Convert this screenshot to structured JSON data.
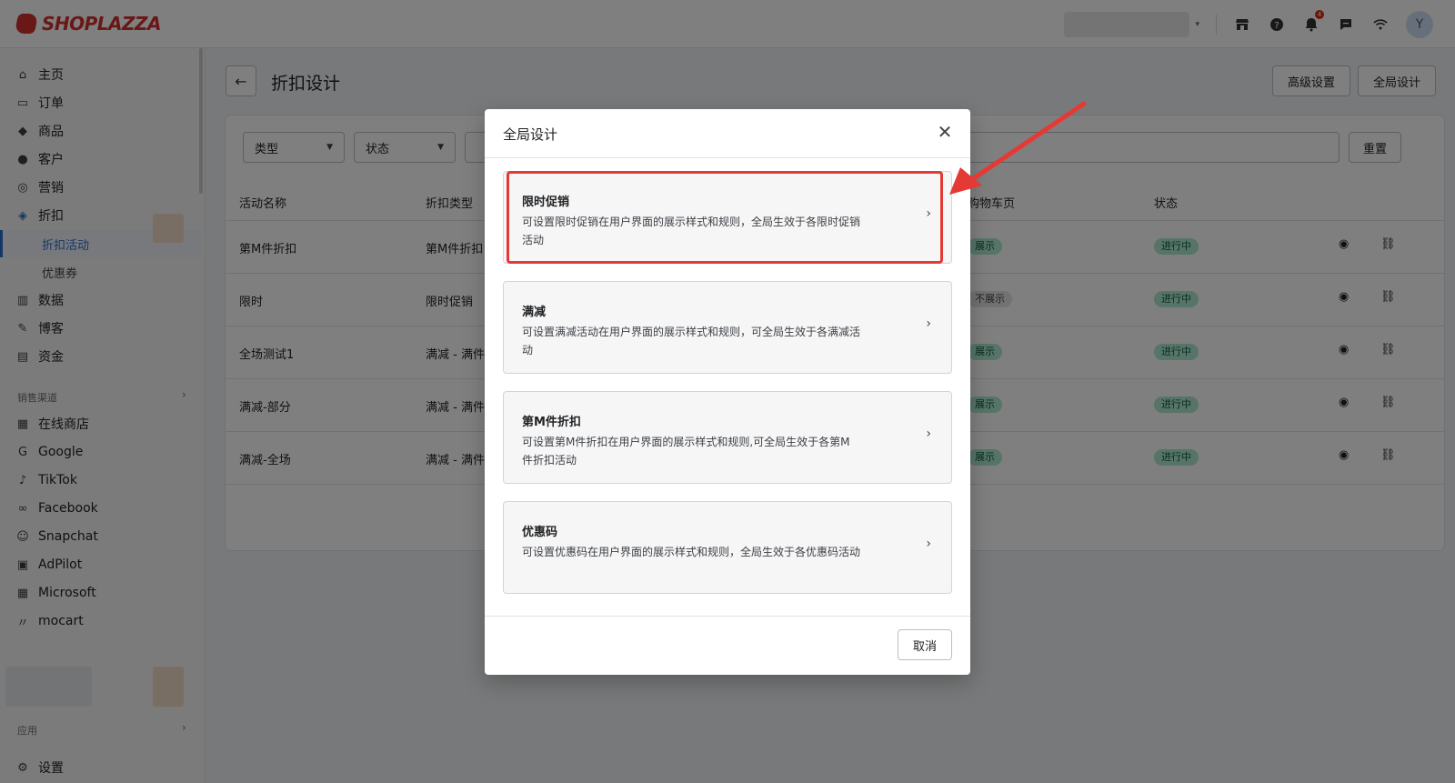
{
  "topbar": {
    "brand": "SHOPLAZZA",
    "notification_count": "4",
    "avatar_initial": "Y"
  },
  "sidebar": {
    "items": [
      {
        "label": "主页",
        "icon": "home-icon"
      },
      {
        "label": "订单",
        "icon": "inbox-icon"
      },
      {
        "label": "商品",
        "icon": "tag-icon"
      },
      {
        "label": "客户",
        "icon": "person-icon"
      },
      {
        "label": "营销",
        "icon": "target-icon"
      },
      {
        "label": "折扣",
        "icon": "discount-icon"
      }
    ],
    "discount_sub": [
      {
        "label": "折扣活动",
        "active": true
      },
      {
        "label": "优惠券",
        "active": false
      }
    ],
    "items2": [
      {
        "label": "数据",
        "icon": "bar-chart-icon"
      },
      {
        "label": "博客",
        "icon": "blog-icon"
      },
      {
        "label": "资金",
        "icon": "wallet-icon"
      }
    ],
    "sales_channel_label": "销售渠道",
    "channels": [
      {
        "label": "在线商店",
        "icon": "store-icon"
      },
      {
        "label": "Google",
        "icon": "google-icon"
      },
      {
        "label": "TikTok",
        "icon": "tiktok-icon"
      },
      {
        "label": "Facebook",
        "icon": "meta-icon"
      },
      {
        "label": "Snapchat",
        "icon": "snapchat-icon"
      },
      {
        "label": "AdPilot",
        "icon": "adpilot-icon"
      },
      {
        "label": "Microsoft",
        "icon": "microsoft-icon"
      },
      {
        "label": "mocart",
        "icon": "mocart-icon"
      }
    ],
    "apps_label": "应用",
    "settings_label": "设置"
  },
  "page": {
    "title": "折扣设计",
    "advanced_settings": "高级设置",
    "global_design": "全局设计"
  },
  "filters": {
    "type": "类型",
    "status": "状态",
    "reset": "重置"
  },
  "table": {
    "headers": {
      "name": "活动名称",
      "discount_type": "折扣类型",
      "cart_page": "购物车页",
      "status": "状态"
    },
    "rows": [
      {
        "name": "第M件折扣",
        "type": "第M件折扣",
        "cart": "展示",
        "cart_style": "green",
        "status": "进行中"
      },
      {
        "name": "限时",
        "type": "限时促销",
        "cart": "不展示",
        "cart_style": "gray",
        "status": "进行中"
      },
      {
        "name": "全场测试1",
        "type": "满减 - 满件",
        "cart": "展示",
        "cart_style": "green",
        "status": "进行中"
      },
      {
        "name": "满减-部分",
        "type": "满减 - 满件",
        "cart": "展示",
        "cart_style": "green",
        "status": "进行中"
      },
      {
        "name": "满减-全场",
        "type": "满减 - 满件",
        "cart": "展示",
        "cart_style": "green",
        "status": "进行中"
      }
    ]
  },
  "modal": {
    "title": "全局设计",
    "options": [
      {
        "title": "限时促销",
        "desc": "可设置限时促销在用户界面的展示样式和规则，全局生效于各限时促销活动"
      },
      {
        "title": "满减",
        "desc": "可设置满减活动在用户界面的展示样式和规则，可全局生效于各满减活动"
      },
      {
        "title": "第M件折扣",
        "desc": "可设置第M件折扣在用户界面的展示样式和规则,可全局生效于各第M件折扣活动"
      },
      {
        "title": "优惠码",
        "desc": "可设置优惠码在用户界面的展示样式和规则，全局生效于各优惠码活动"
      }
    ],
    "cancel": "取消"
  },
  "colors": {
    "brand_red": "#d32f2f",
    "highlight": "#e53935",
    "accent_blue": "#2c6ecb",
    "badge_green": "#aee9d1"
  }
}
